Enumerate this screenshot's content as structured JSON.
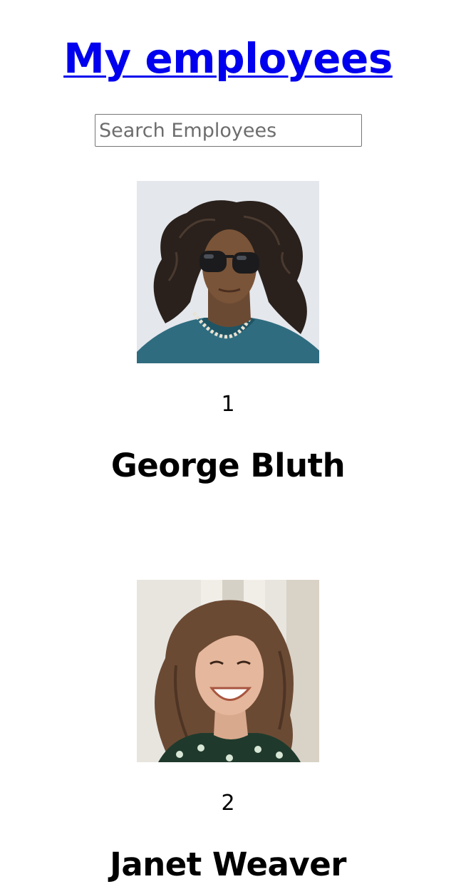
{
  "header": {
    "title": "My employees"
  },
  "search": {
    "placeholder": "Search Employees",
    "value": ""
  },
  "employees": [
    {
      "id": "1",
      "name": "George Bluth",
      "photo_icon": "portrait-man-sunglasses"
    },
    {
      "id": "2",
      "name": "Janet Weaver",
      "photo_icon": "portrait-woman-smiling"
    }
  ]
}
